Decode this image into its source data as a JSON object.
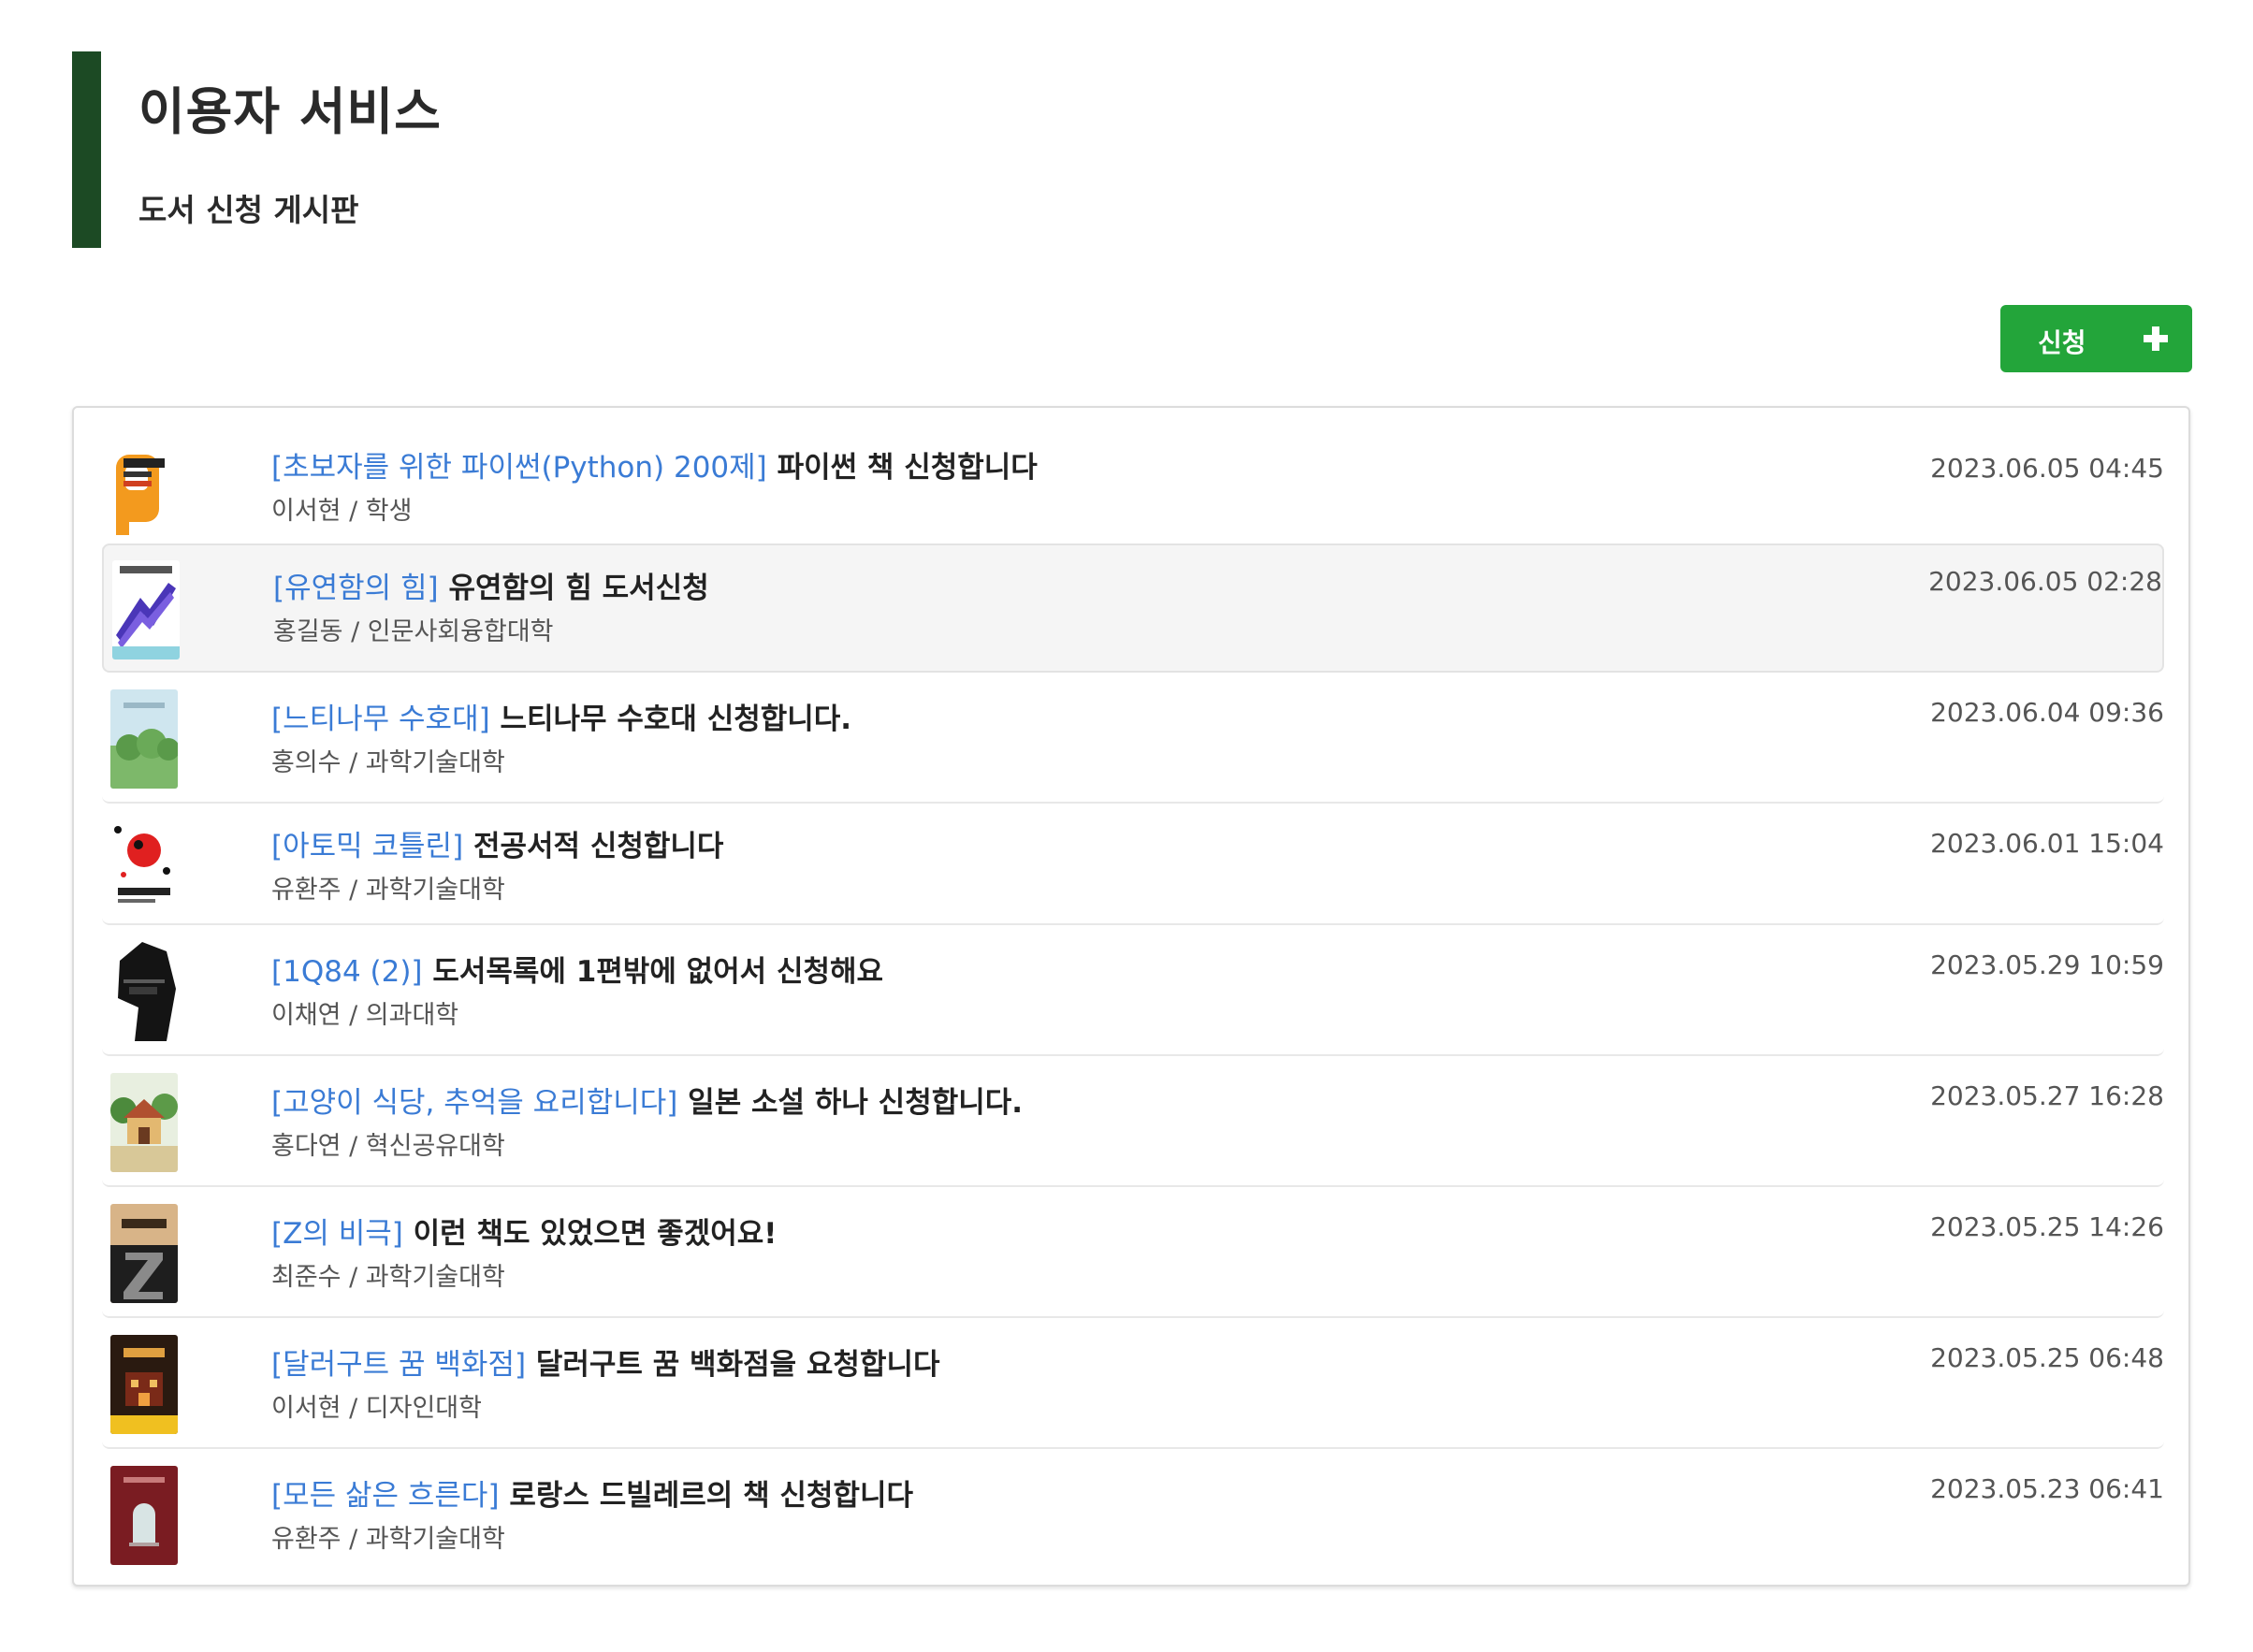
{
  "header": {
    "title": "이용자 서비스",
    "subtitle": "도서 신청 게시판"
  },
  "toolbar": {
    "request_label": "신청"
  },
  "colors": {
    "brand_green": "#1c4a24",
    "button_green": "#23a53a",
    "link_blue": "#3a7bd5"
  },
  "items": [
    {
      "book": "[초보자를 위한 파이썬(Python) 200제]",
      "title": "파이썬 책 신청합니다",
      "author": "이서현 / 학생",
      "date": "2023.06.05 04:45",
      "cover": "python-200-cover"
    },
    {
      "book": "[유연함의 힘]",
      "title": "유연함의 힘 도서신청",
      "author": "홍길동 / 인문사회융합대학",
      "date": "2023.06.05 02:28",
      "cover": "flexibility-cover"
    },
    {
      "book": "[느티나무 수호대]",
      "title": "느티나무 수호대 신청합니다.",
      "author": "홍의수 / 과학기술대학",
      "date": "2023.06.04 09:36",
      "cover": "zelkova-cover"
    },
    {
      "book": "[아토믹 코틀린]",
      "title": "전공서적 신청합니다",
      "author": "유환주 / 과학기술대학",
      "date": "2023.06.01 15:04",
      "cover": "atomic-kotlin-cover"
    },
    {
      "book": "[1Q84 (2)]",
      "title": "도서목록에 1편밖에 없어서 신청해요",
      "author": "이채연 / 의과대학",
      "date": "2023.05.29 10:59",
      "cover": "1q84-cover"
    },
    {
      "book": "[고양이 식당, 추억을 요리합니다]",
      "title": "일본 소설 하나 신청합니다.",
      "author": "홍다연 / 혁신공유대학",
      "date": "2023.05.27 16:28",
      "cover": "cat-diner-cover"
    },
    {
      "book": "[Z의 비극]",
      "title": "이런 책도 있었으면 좋겠어요!",
      "author": "최준수 / 과학기술대학",
      "date": "2023.05.25 14:26",
      "cover": "tragedy-z-cover"
    },
    {
      "book": "[달러구트 꿈 백화점]",
      "title": "달러구트 꿈 백화점을 요청합니다",
      "author": "이서현 / 디자인대학",
      "date": "2023.05.25 06:48",
      "cover": "dallergut-cover"
    },
    {
      "book": "[모든 삶은 흐른다]",
      "title": "로랑스 드빌레르의 책 신청합니다",
      "author": "유환주 / 과학기술대학",
      "date": "2023.05.23 06:41",
      "cover": "all-life-flows-cover"
    }
  ]
}
